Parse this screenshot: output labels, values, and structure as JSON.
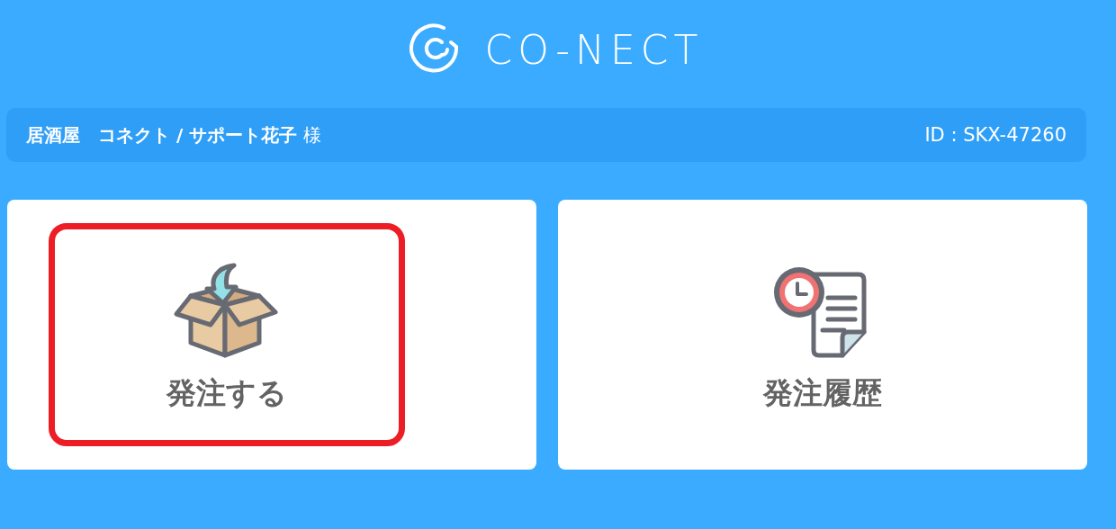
{
  "logo": {
    "text": "CO-NECT"
  },
  "account": {
    "user": "**居酒屋　コネクト / サポート花子** 様",
    "id": "ID : SKX-47260"
  },
  "menu": [
    {
      "kind": "order",
      "label": "発注する",
      "highlighted": true
    },
    {
      "kind": "history",
      "label": "発注履歴",
      "highlighted": false
    }
  ]
}
